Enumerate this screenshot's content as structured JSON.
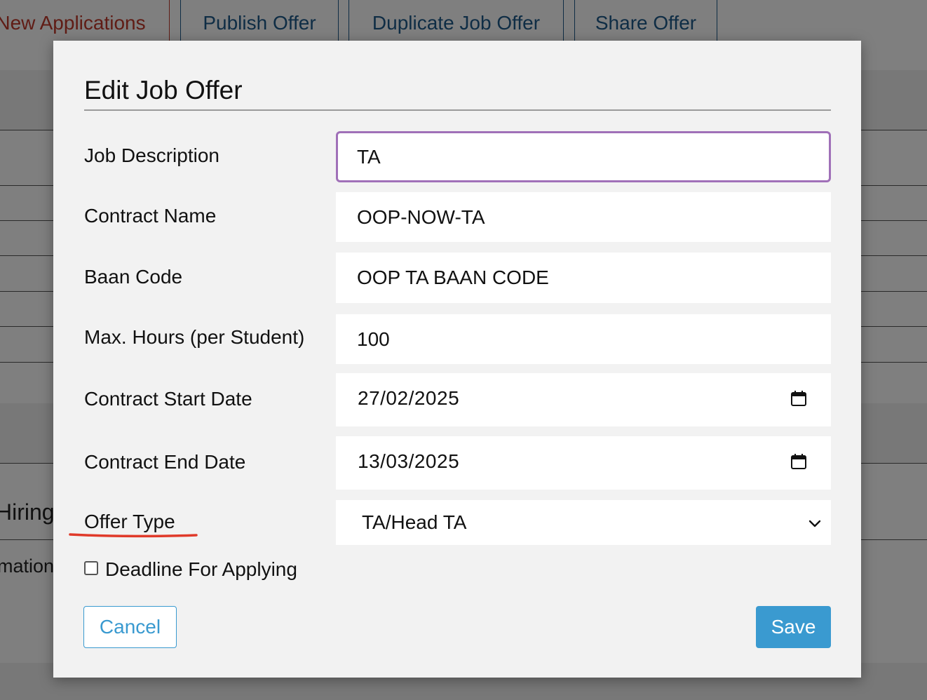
{
  "background": {
    "tabs": [
      {
        "label": "New Applications"
      },
      {
        "label": "Publish Offer"
      },
      {
        "label": "Duplicate Job Offer"
      },
      {
        "label": "Share Offer"
      }
    ],
    "partial_texts": {
      "hiring": "Hiring",
      "information": "mation"
    }
  },
  "modal": {
    "title": "Edit Job Offer",
    "fields": {
      "job_description": {
        "label": "Job Description",
        "value": "TA"
      },
      "contract_name": {
        "label": "Contract Name",
        "value": "OOP-NOW-TA"
      },
      "baan_code": {
        "label": "Baan Code",
        "value": "OOP TA BAAN CODE"
      },
      "max_hours": {
        "label": "Max. Hours (per Student)",
        "value": "100"
      },
      "contract_start_date": {
        "label": "Contract Start Date",
        "value": "27/02/2025"
      },
      "contract_end_date": {
        "label": "Contract End Date",
        "value": "13/03/2025"
      },
      "offer_type": {
        "label": "Offer Type",
        "value": "TA/Head TA"
      }
    },
    "deadline_checkbox": {
      "label": "Deadline For Applying",
      "checked": false
    },
    "buttons": {
      "cancel": "Cancel",
      "save": "Save"
    },
    "colors": {
      "focus_border": "#a070b8",
      "primary": "#3a9ad0",
      "annotation": "#e03a2a",
      "active_tab": "#c0392b"
    }
  }
}
